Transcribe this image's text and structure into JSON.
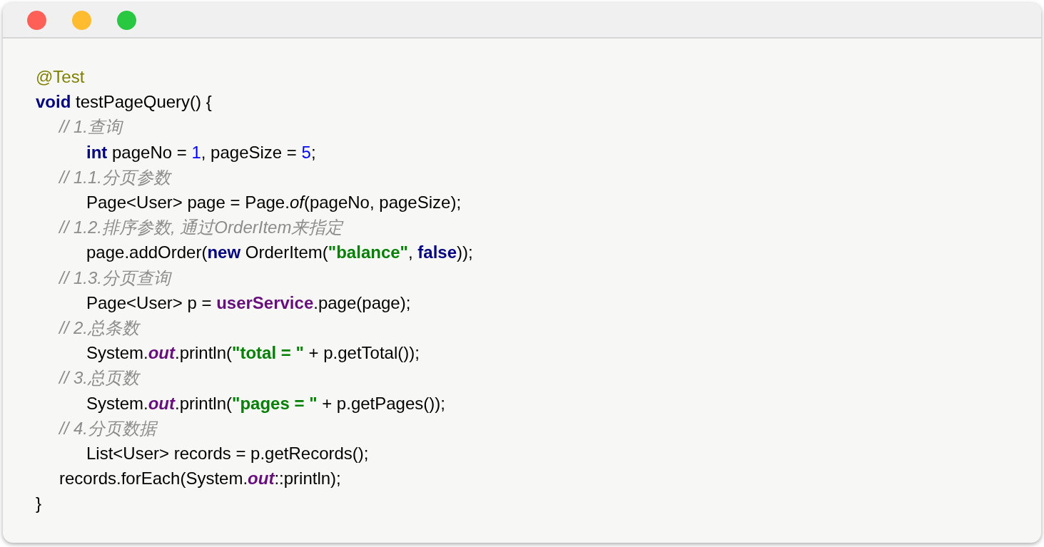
{
  "window": {
    "controls": [
      {
        "color": "#fe5f57"
      },
      {
        "color": "#febc2e"
      },
      {
        "color": "#28c840"
      }
    ]
  },
  "code": {
    "lines": [
      {
        "tokens": [
          {
            "text": "@Test",
            "kind": "annotation"
          }
        ]
      },
      {
        "tokens": [
          {
            "text": "void",
            "kind": "keyword"
          },
          {
            "text": " testPageQuery() {",
            "kind": "plain"
          }
        ],
        "children": [
          {
            "tokens": [
              {
                "text": "// 1.查询",
                "kind": "comment"
              }
            ],
            "children": [
              {
                "tokens": [
                  {
                    "text": "int",
                    "kind": "keyword"
                  },
                  {
                    "text": " pageNo = ",
                    "kind": "plain"
                  },
                  {
                    "text": "1",
                    "kind": "number"
                  },
                  {
                    "text": ", pageSize = ",
                    "kind": "plain"
                  },
                  {
                    "text": "5",
                    "kind": "number"
                  },
                  {
                    "text": ";",
                    "kind": "plain"
                  }
                ]
              }
            ]
          },
          {
            "tokens": [
              {
                "text": "// 1.1.分页参数",
                "kind": "comment"
              }
            ],
            "children": [
              {
                "tokens": [
                  {
                    "text": "Page<User> page = Page.",
                    "kind": "plain"
                  },
                  {
                    "text": "of",
                    "kind": "static-method"
                  },
                  {
                    "text": "(pageNo, pageSize);",
                    "kind": "plain"
                  }
                ]
              }
            ]
          },
          {
            "tokens": [
              {
                "text": "// 1.2.排序参数, 通过OrderItem来指定",
                "kind": "comment"
              }
            ],
            "children": [
              {
                "tokens": [
                  {
                    "text": "page.addOrder(",
                    "kind": "plain"
                  },
                  {
                    "text": "new",
                    "kind": "keyword"
                  },
                  {
                    "text": " OrderItem(",
                    "kind": "plain"
                  },
                  {
                    "text": "\"balance\"",
                    "kind": "string"
                  },
                  {
                    "text": ", ",
                    "kind": "plain"
                  },
                  {
                    "text": "false",
                    "kind": "keyword"
                  },
                  {
                    "text": "));",
                    "kind": "plain"
                  }
                ]
              }
            ]
          },
          {
            "tokens": [
              {
                "text": "// 1.3.分页查询",
                "kind": "comment"
              }
            ],
            "children": [
              {
                "tokens": [
                  {
                    "text": "Page<User> p = ",
                    "kind": "plain"
                  },
                  {
                    "text": "userService",
                    "kind": "field"
                  },
                  {
                    "text": ".page(page);",
                    "kind": "plain"
                  }
                ]
              }
            ]
          },
          {
            "tokens": [
              {
                "text": "// 2.总条数",
                "kind": "comment"
              }
            ],
            "children": [
              {
                "tokens": [
                  {
                    "text": "System.",
                    "kind": "plain"
                  },
                  {
                    "text": "out",
                    "kind": "static-field"
                  },
                  {
                    "text": ".println(",
                    "kind": "plain"
                  },
                  {
                    "text": "\"total = \"",
                    "kind": "string"
                  },
                  {
                    "text": " + p.getTotal());",
                    "kind": "plain"
                  }
                ]
              }
            ]
          },
          {
            "tokens": [
              {
                "text": "// 3.总页数",
                "kind": "comment"
              }
            ],
            "children": [
              {
                "tokens": [
                  {
                    "text": "System.",
                    "kind": "plain"
                  },
                  {
                    "text": "out",
                    "kind": "static-field"
                  },
                  {
                    "text": ".println(",
                    "kind": "plain"
                  },
                  {
                    "text": "\"pages = \"",
                    "kind": "string"
                  },
                  {
                    "text": " + p.getPages());",
                    "kind": "plain"
                  }
                ]
              }
            ]
          },
          {
            "tokens": [
              {
                "text": "// 4.分页数据",
                "kind": "comment"
              }
            ],
            "children": [
              {
                "tokens": [
                  {
                    "text": "List<User> records = p.getRecords();",
                    "kind": "plain"
                  }
                ]
              }
            ]
          },
          {
            "tokens": [
              {
                "text": "records.forEach(System.",
                "kind": "plain"
              },
              {
                "text": "out",
                "kind": "static-field"
              },
              {
                "text": "::println);",
                "kind": "plain"
              }
            ]
          }
        ]
      },
      {
        "tokens": [
          {
            "text": "}",
            "kind": "plain"
          }
        ]
      }
    ]
  }
}
